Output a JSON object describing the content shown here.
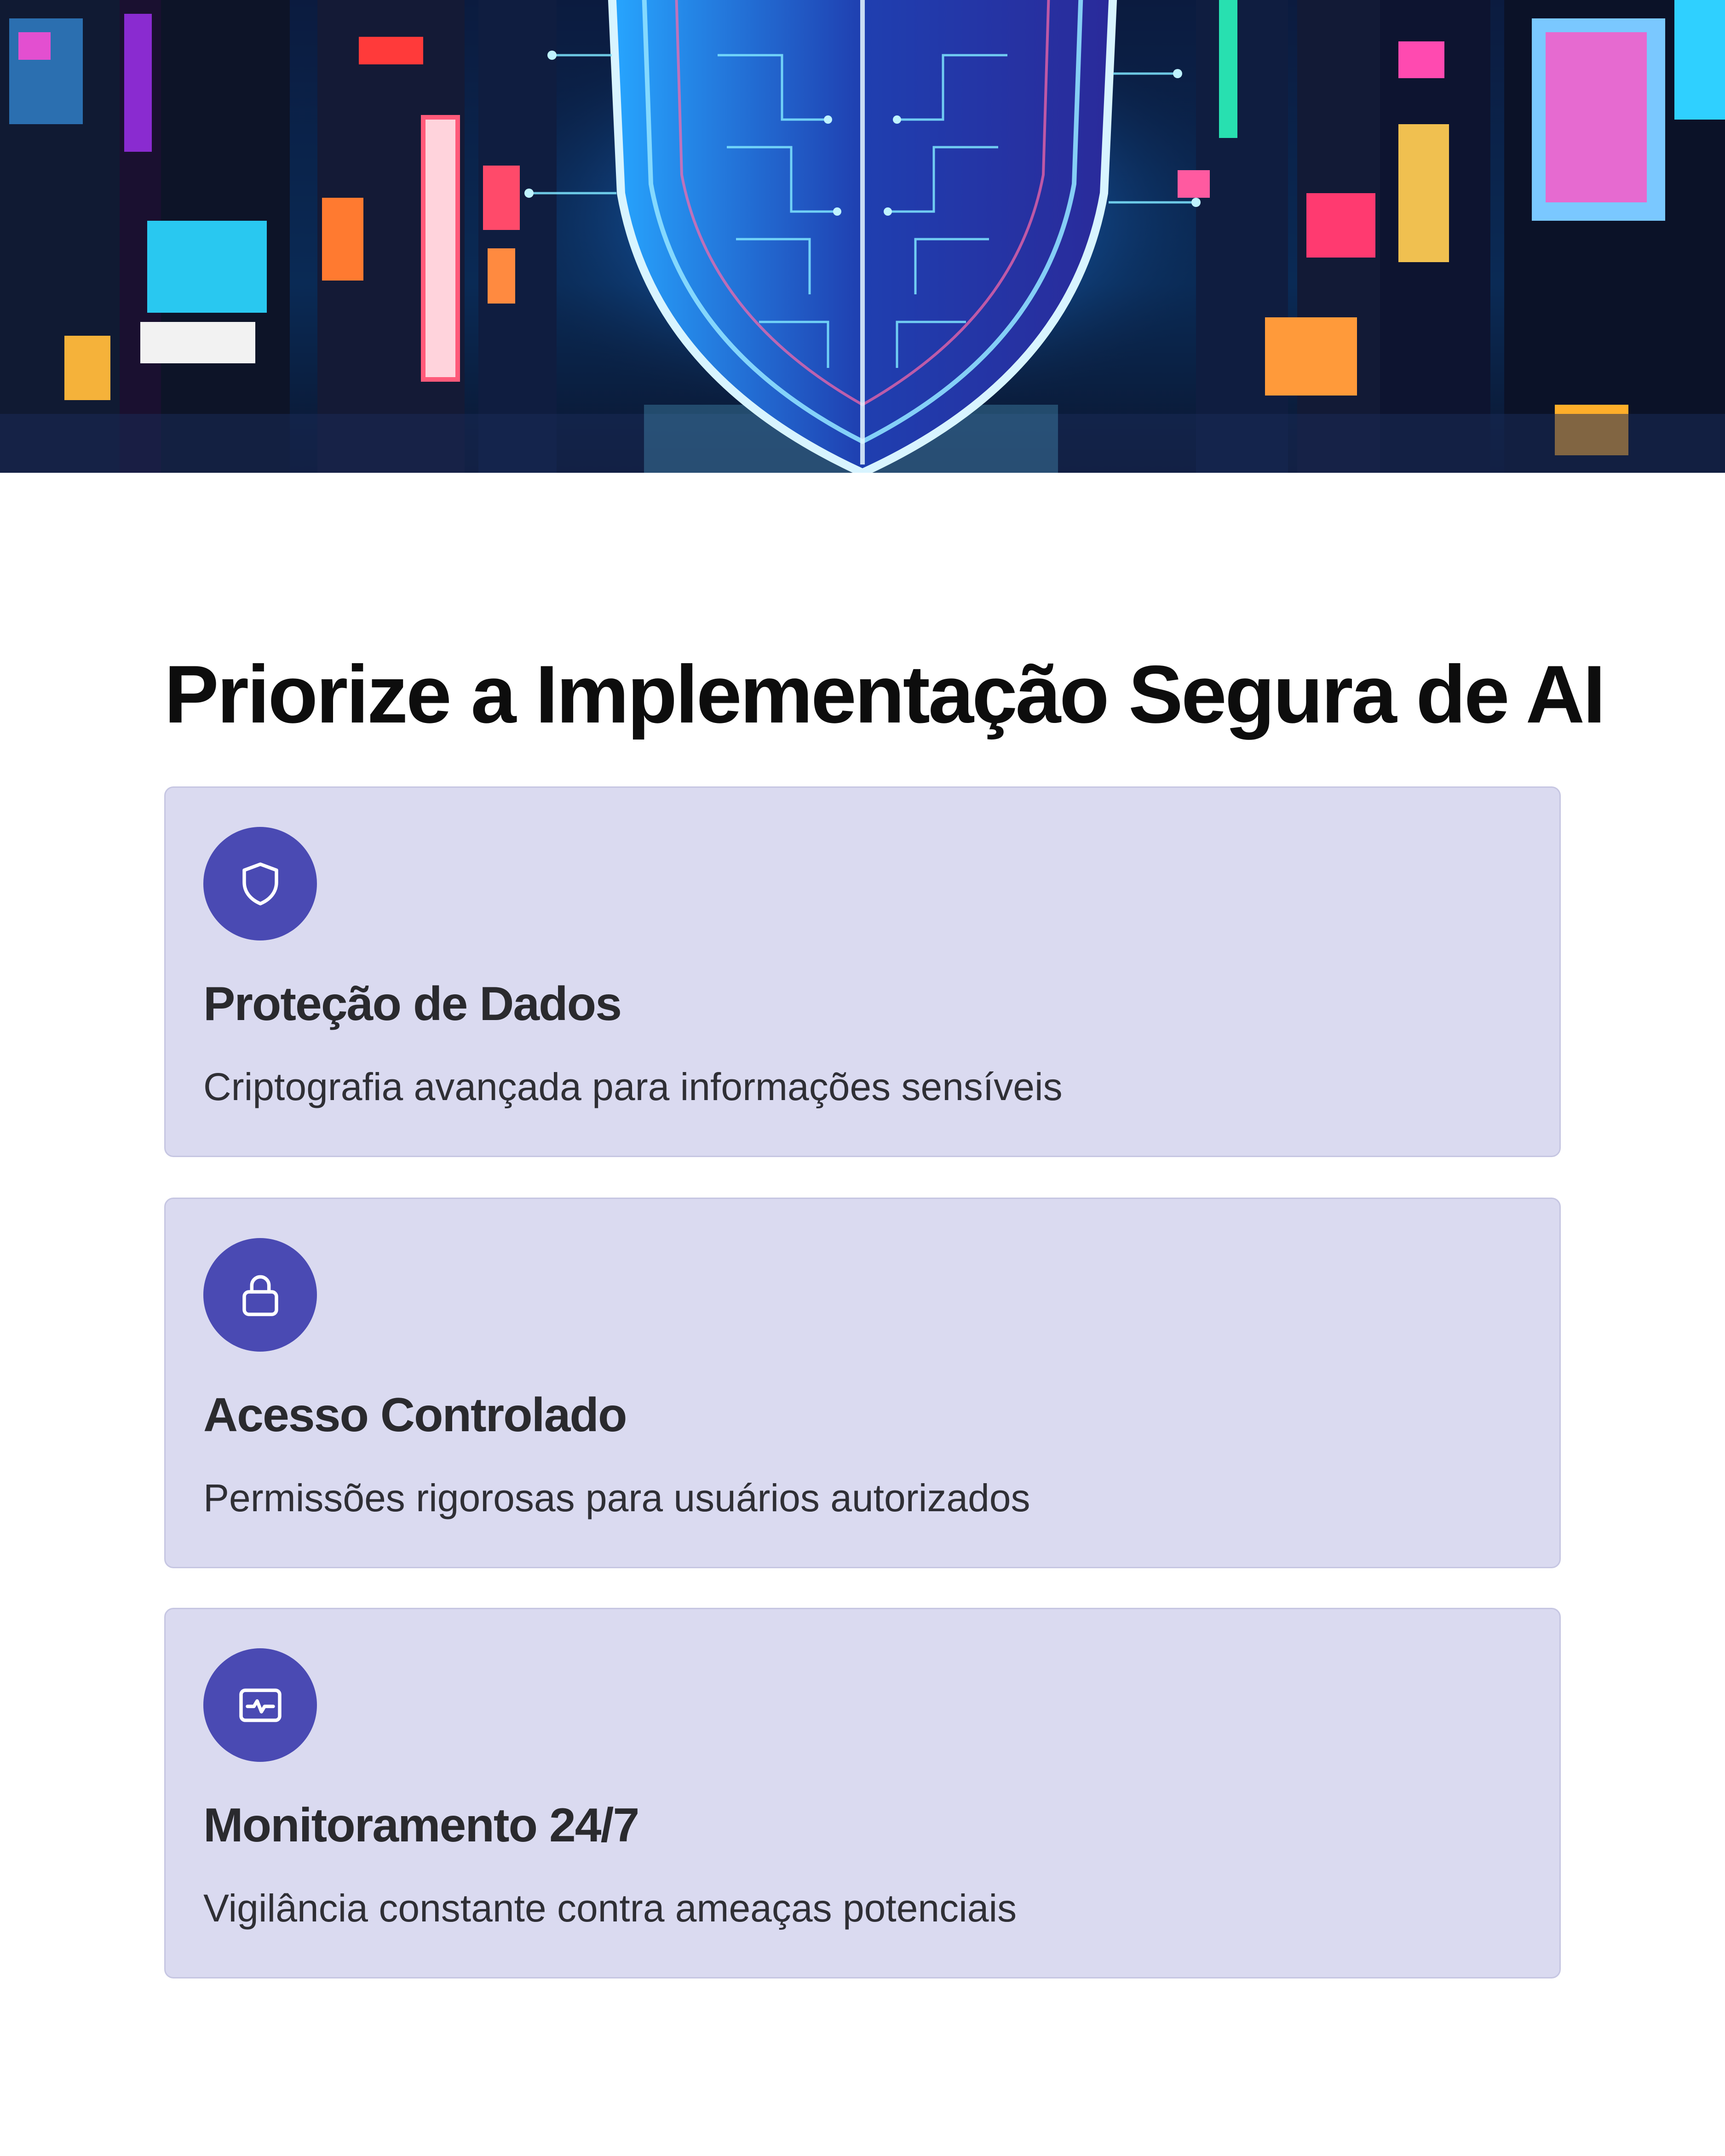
{
  "hero": {
    "image_description_icon": "cyber-shield-city-image"
  },
  "page": {
    "title": "Priorize a Implementação Segura de AI"
  },
  "cards": [
    {
      "icon": "shield-icon",
      "title": "Proteção de Dados",
      "description": "Criptografia avançada para informações sensíveis"
    },
    {
      "icon": "lock-icon",
      "title": "Acesso Controlado",
      "description": "Permissões rigorosas para usuários autorizados"
    },
    {
      "icon": "monitor-pulse-icon",
      "title": "Monitoramento 24/7",
      "description": "Vigilância constante contra ameaças potenciais"
    }
  ],
  "colors": {
    "card_background": "#dadaf0",
    "card_border": "#c6c6e2",
    "icon_circle": "#4a4ab3",
    "icon_stroke": "#ffffff",
    "title_text": "#0d0d0d",
    "body_text": "#2f2f35"
  }
}
